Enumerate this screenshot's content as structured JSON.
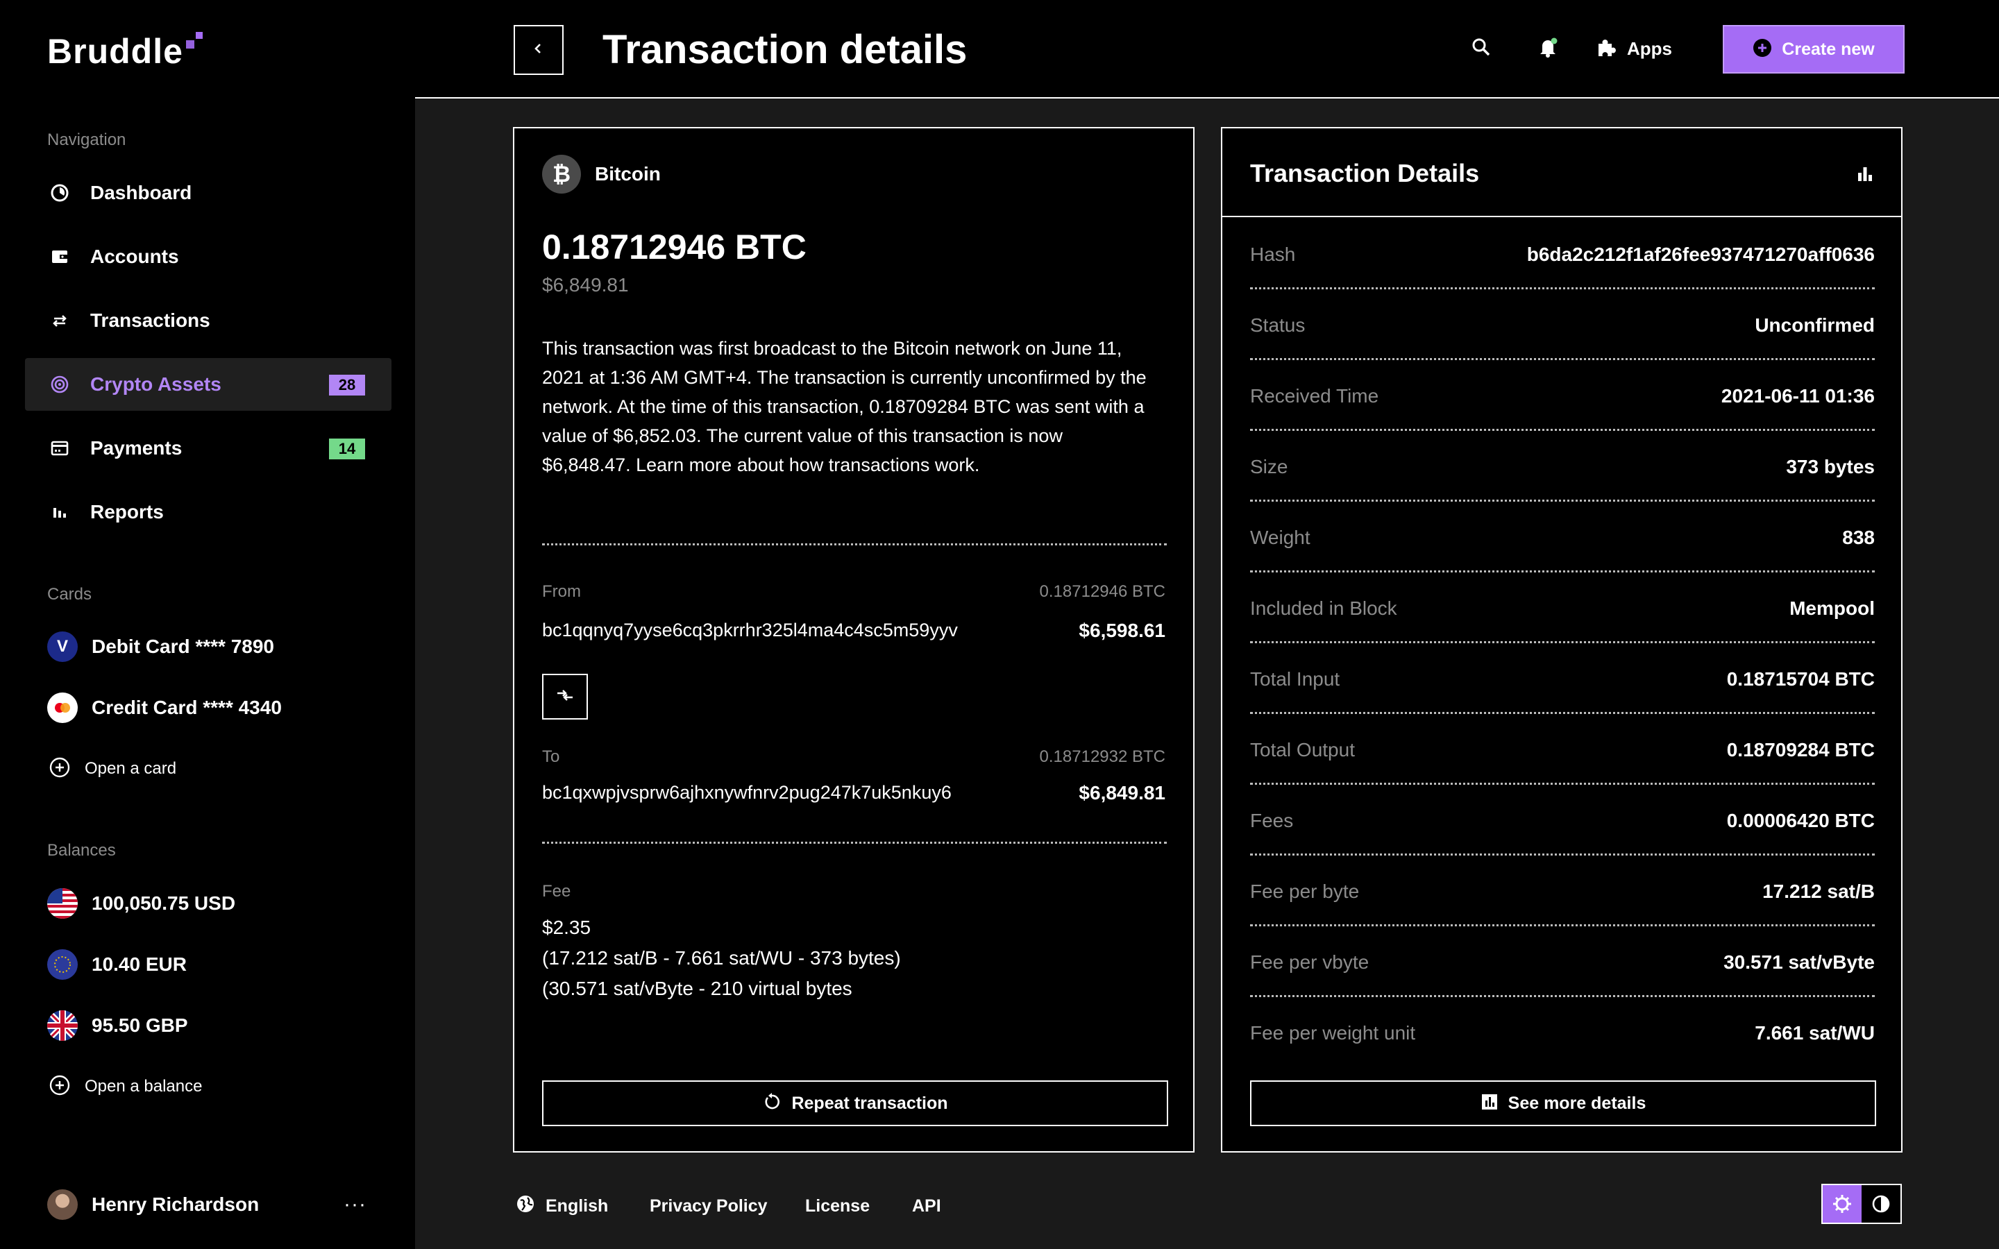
{
  "app": {
    "logo": "Bruddle"
  },
  "sidebar": {
    "nav_title": "Navigation",
    "nav": [
      {
        "label": "Dashboard",
        "icon": "dashboard-icon"
      },
      {
        "label": "Accounts",
        "icon": "wallet-icon"
      },
      {
        "label": "Transactions",
        "icon": "arrows-swap-icon"
      },
      {
        "label": "Crypto Assets",
        "icon": "crypto-icon",
        "badge": "28",
        "active": true
      },
      {
        "label": "Payments",
        "icon": "card-icon",
        "badge": "14"
      },
      {
        "label": "Reports",
        "icon": "bar-chart-icon"
      }
    ],
    "cards_title": "Cards",
    "cards": [
      {
        "label": "Debit Card **** 7890",
        "icon": "visa-icon",
        "letter": "V"
      },
      {
        "label": "Credit Card **** 4340",
        "icon": "mastercard-icon"
      }
    ],
    "open_card": "Open a card",
    "balances_title": "Balances",
    "balances": [
      {
        "label": "100,050.75 USD",
        "icon": "us-flag-icon"
      },
      {
        "label": "10.40 EUR",
        "icon": "eu-flag-icon"
      },
      {
        "label": "95.50 GBP",
        "icon": "uk-flag-icon"
      }
    ],
    "open_balance": "Open a balance",
    "user": {
      "name": "Henry Richardson",
      "more": "···"
    }
  },
  "header": {
    "title": "Transaction details",
    "apps": "Apps",
    "create": "Create new"
  },
  "transaction": {
    "asset": "Bitcoin",
    "asset_symbol": "₿",
    "amount": "0.18712946 BTC",
    "amount_usd": "$6,849.81",
    "description": "This transaction was first broadcast to the Bitcoin network on June 11, 2021 at 1:36 AM GMT+4.  The transaction is currently unconfirmed by the network.  At the time of this transaction, 0.18709284 BTC was sent with a value of $6,852.03. The current value of this transaction is now $6,848.47.  Learn more about how transactions work.",
    "from_label": "From",
    "from_btc": "0.18712946 BTC",
    "from_address": "bc1qqnyq7yyse6cq3pkrrhr325l4ma4c4sc5m59yyv",
    "from_usd": "$6,598.61",
    "to_label": "To",
    "to_btc": "0.18712932 BTC",
    "to_address": "bc1qxwpjvsprw6ajhxnywfnrv2pug247k7uk5nkuy6",
    "to_usd": "$6,849.81",
    "fee_label": "Fee",
    "fee_usd": "$2.35",
    "fee_line1": "(17.212 sat/B - 7.661 sat/WU - 373 bytes)",
    "fee_line2": "(30.571 sat/vByte - 210 virtual bytes",
    "repeat_button": "Repeat transaction"
  },
  "details": {
    "title": "Transaction Details",
    "rows": [
      {
        "key": "Hash",
        "value": "b6da2c212f1af26fee937471270aff0636"
      },
      {
        "key": "Status",
        "value": "Unconfirmed"
      },
      {
        "key": "Received Time",
        "value": "2021-06-11 01:36"
      },
      {
        "key": "Size",
        "value": "373 bytes"
      },
      {
        "key": "Weight",
        "value": "838"
      },
      {
        "key": "Included in Block",
        "value": "Mempool"
      },
      {
        "key": "Total Input",
        "value": "0.18715704 BTC"
      },
      {
        "key": "Total Output",
        "value": "0.18709284 BTC"
      },
      {
        "key": "Fees",
        "value": "0.00006420 BTC"
      },
      {
        "key": "Fee per byte",
        "value": "17.212 sat/B"
      },
      {
        "key": "Fee per vbyte",
        "value": "30.571 sat/vByte"
      },
      {
        "key": "Fee per weight unit",
        "value": "7.661 sat/WU"
      }
    ],
    "more_button": "See more details"
  },
  "footer": {
    "language": "English",
    "privacy": "Privacy Policy",
    "license": "License",
    "api": "API"
  },
  "colors": {
    "accent": "#a56cf5",
    "badge_green": "#74d98a",
    "background": "#1a1a1a",
    "panel": "#000000"
  }
}
